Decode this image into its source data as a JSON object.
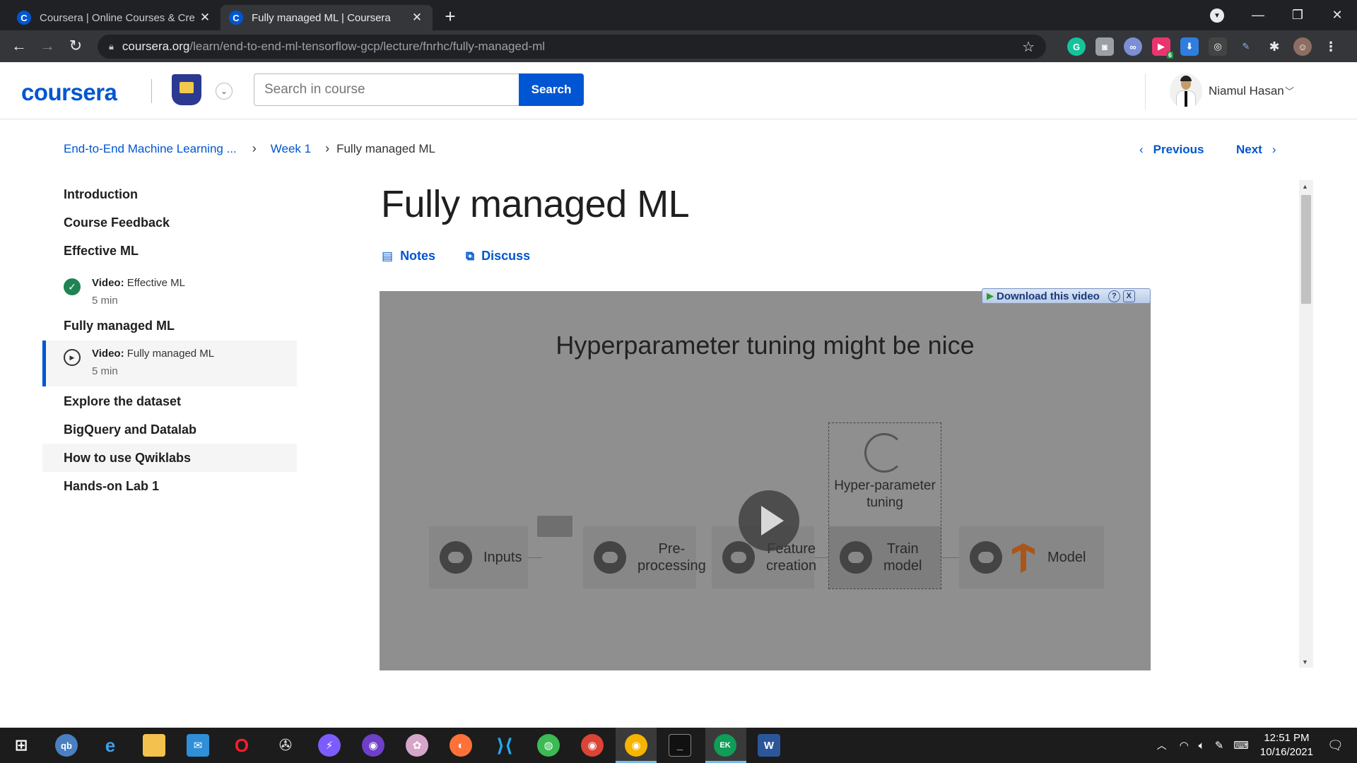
{
  "browser": {
    "tabs": [
      {
        "title": "Coursera | Online Courses & Cre",
        "favicon": "C"
      },
      {
        "title": "Fully managed ML | Coursera",
        "favicon": "C"
      }
    ],
    "url_host": "coursera.org",
    "url_path": "/learn/end-to-end-ml-tensorflow-gcp/lecture/fnrhc/fully-managed-ml",
    "extension_badge": "6"
  },
  "header": {
    "logo": "coursera",
    "search_placeholder": "Search in course",
    "search_button": "Search",
    "user_name": "Niamul Hasan"
  },
  "breadcrumb": {
    "course": "End-to-End Machine Learning ...",
    "week": "Week 1",
    "current": "Fully managed ML"
  },
  "nav": {
    "previous": "Previous",
    "next": "Next"
  },
  "sidebar": {
    "headings": [
      "Introduction",
      "Course Feedback",
      "Effective ML",
      "Fully managed ML",
      "Explore the dataset",
      "BigQuery and Datalab",
      "How to use Qwiklabs",
      "Hands-on Lab 1"
    ],
    "items": [
      {
        "type": "Video:",
        "name": "Effective ML",
        "duration": "5 min",
        "status": "complete"
      },
      {
        "type": "Video:",
        "name": "Fully managed ML",
        "duration": "5 min",
        "status": "current"
      }
    ]
  },
  "main": {
    "title": "Fully managed ML",
    "notes": "Notes",
    "discuss": "Discuss"
  },
  "video": {
    "slide_title": "Hyperparameter tuning might be nice",
    "steps": [
      "Inputs",
      "Pre-\nprocessing",
      "Feature\ncreation",
      "Train\nmodel",
      "Model"
    ],
    "hyper_label": "Hyper-parameter\ntuning",
    "download_label": "Download this video",
    "help": "?",
    "close": "X"
  },
  "taskbar": {
    "time": "12:51 PM",
    "date": "10/16/2021"
  },
  "colors": {
    "accent": "#0056d2",
    "complete": "#1f8354",
    "chrome_dark": "#202124",
    "taskbar": "#1c1c1c"
  }
}
